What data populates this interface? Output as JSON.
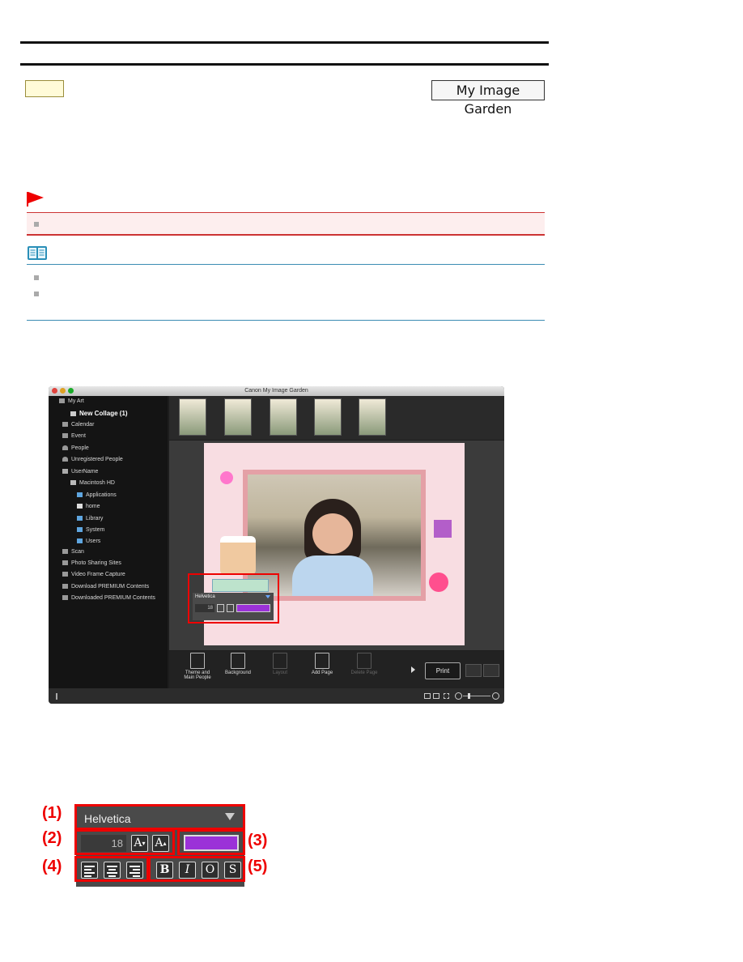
{
  "header": {
    "app_badge": "My Image Garden"
  },
  "screenshot": {
    "window_title": "Canon My Image Garden",
    "sidebar": [
      {
        "label": "My Art",
        "icon": "my-art-icon"
      },
      {
        "label": "New Collage (1)",
        "icon": "collage-icon"
      },
      {
        "label": "Calendar",
        "icon": "calendar-icon"
      },
      {
        "label": "Event",
        "icon": "event-icon"
      },
      {
        "label": "People",
        "icon": "people-icon"
      },
      {
        "label": "Unregistered People",
        "icon": "unregistered-people-icon"
      },
      {
        "label": "UserName",
        "icon": "computer-icon"
      },
      {
        "label": "Macintosh HD",
        "icon": "drive-icon"
      },
      {
        "label": "Applications",
        "icon": "folder-icon"
      },
      {
        "label": "home",
        "icon": "home-icon"
      },
      {
        "label": "Library",
        "icon": "folder-icon"
      },
      {
        "label": "System",
        "icon": "folder-icon"
      },
      {
        "label": "Users",
        "icon": "folder-icon"
      },
      {
        "label": "Scan",
        "icon": "scan-icon"
      },
      {
        "label": "Photo Sharing Sites",
        "icon": "photo-sharing-icon"
      },
      {
        "label": "Video Frame Capture",
        "icon": "video-capture-icon"
      },
      {
        "label": "Download PREMIUM Contents",
        "icon": "download-icon"
      },
      {
        "label": "Downloaded PREMIUM Contents",
        "icon": "downloaded-folder-icon"
      }
    ],
    "mini_palette": {
      "font": "Helvetica",
      "size": "18"
    },
    "toolbar": {
      "theme": "Theme and\nMain People",
      "background": "Background",
      "layout": "Layout",
      "add_page": "Add Page",
      "delete_page": "Delete Page",
      "print": "Print"
    }
  },
  "palette": {
    "font": "Helvetica",
    "size": "18",
    "text_color": "#9b32d8",
    "callouts": [
      "(1)",
      "(2)",
      "(3)",
      "(4)",
      "(5)"
    ],
    "style_buttons": [
      "B",
      "I",
      "O",
      "S"
    ]
  },
  "colors": {
    "important": "#cc3333",
    "note": "#3b8cb3",
    "callout": "#e00000"
  }
}
